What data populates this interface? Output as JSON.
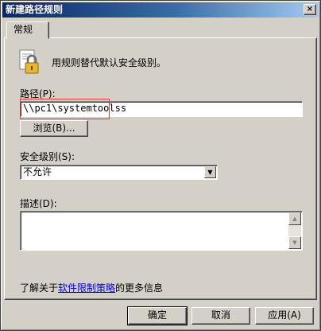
{
  "window": {
    "title": "新建路径规则",
    "close_glyph": "×"
  },
  "tabs": [
    {
      "label": "常规"
    }
  ],
  "general": {
    "description": "用规则替代默认安全级别。",
    "path_label": "路径(P):",
    "path_value": "\\\\pc1\\systemtoolss",
    "browse_label": "浏览(B)...",
    "security_label": "安全级别(S):",
    "security_value": "不允许",
    "notes_label": "描述(D):",
    "notes_value": "",
    "info_prefix": "了解关于",
    "info_link": "软件限制策略",
    "info_suffix": "的更多信息"
  },
  "footer": {
    "ok": "确定",
    "cancel": "取消",
    "apply": "应用(A)"
  },
  "icons": {
    "lock": "lock-icon",
    "dropdown": "▼",
    "scroll_up": "▲",
    "scroll_down": "▼"
  },
  "colors": {
    "highlight_border": "#e0393e",
    "title_start": "#0a246a",
    "link": "#0000ff"
  }
}
